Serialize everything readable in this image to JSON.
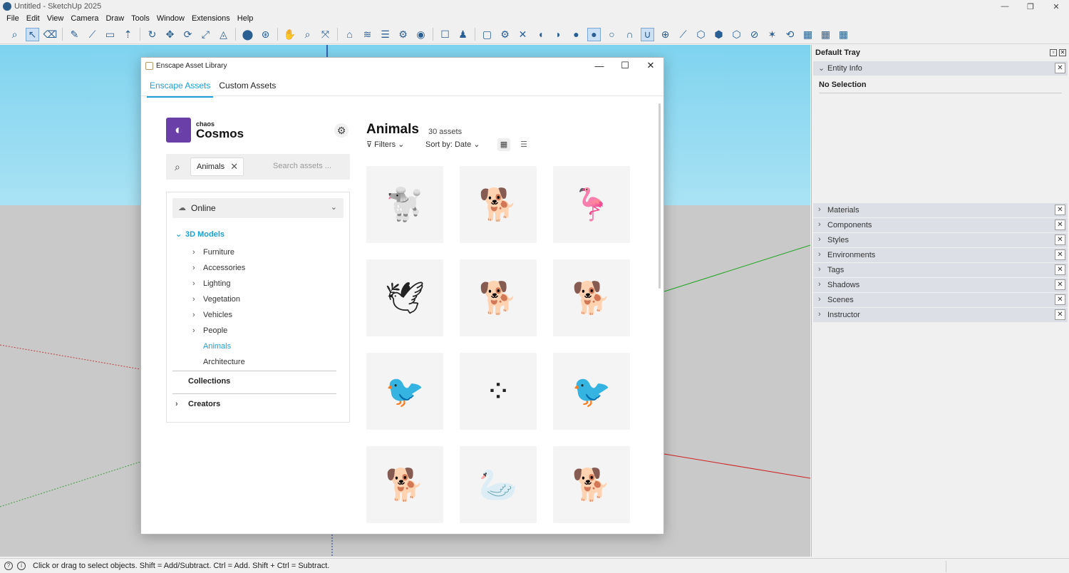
{
  "window": {
    "title": "Untitled - SketchUp 2025",
    "controls": [
      "—",
      "❐",
      "✕"
    ]
  },
  "menu": [
    "File",
    "Edit",
    "View",
    "Camera",
    "Draw",
    "Tools",
    "Window",
    "Extensions",
    "Help"
  ],
  "toolbar_icons": [
    {
      "name": "search-icon",
      "glyph": "⌕"
    },
    {
      "name": "select-icon",
      "glyph": "↖",
      "selected": true
    },
    {
      "name": "eraser-icon",
      "glyph": "⌫"
    },
    {
      "name": "pencil-icon",
      "glyph": "✎"
    },
    {
      "name": "line-icon",
      "glyph": "⟋"
    },
    {
      "name": "rectangle-icon",
      "glyph": "▭"
    },
    {
      "name": "push-pull-icon",
      "glyph": "⇡"
    },
    {
      "name": "offset-icon",
      "glyph": "↻"
    },
    {
      "name": "move-icon",
      "glyph": "✥"
    },
    {
      "name": "rotate-icon",
      "glyph": "⟳"
    },
    {
      "name": "scale-icon",
      "glyph": "⤢"
    },
    {
      "name": "protractor-icon",
      "glyph": "◬"
    },
    {
      "name": "paint-icon",
      "glyph": "⬤"
    },
    {
      "name": "orbit-icon",
      "glyph": "⊛"
    },
    {
      "name": "pan-icon",
      "glyph": "✋"
    },
    {
      "name": "zoom-icon",
      "glyph": "⌕"
    },
    {
      "name": "zoom-extents-icon",
      "glyph": "⤧"
    },
    {
      "name": "warehouse-icon",
      "glyph": "⌂"
    },
    {
      "name": "layers-icon",
      "glyph": "≋"
    },
    {
      "name": "stack-icon",
      "glyph": "☰"
    },
    {
      "name": "settings-icon",
      "glyph": "⚙"
    },
    {
      "name": "user-icon",
      "glyph": "◉"
    },
    {
      "name": "page-icon",
      "glyph": "☐"
    },
    {
      "name": "person-icon",
      "glyph": "♟"
    },
    {
      "name": "folder-icon",
      "glyph": "▢"
    },
    {
      "name": "gear-icon",
      "glyph": "⚙"
    },
    {
      "name": "close-icon",
      "glyph": "✕"
    },
    {
      "name": "drop-icon",
      "glyph": "◖"
    },
    {
      "name": "drop-half-icon",
      "glyph": "◗"
    },
    {
      "name": "drop-filled-icon",
      "glyph": "●"
    },
    {
      "name": "drop-selected-icon",
      "glyph": "●",
      "selected": true
    },
    {
      "name": "drop-outline-icon",
      "glyph": "○"
    },
    {
      "name": "magnet-icon",
      "glyph": "∩"
    },
    {
      "name": "magnet-selected-icon",
      "glyph": "∪",
      "selected": true
    },
    {
      "name": "add-icon",
      "glyph": "⊕"
    },
    {
      "name": "connect-icon",
      "glyph": "⟋"
    },
    {
      "name": "box-icon",
      "glyph": "⬡"
    },
    {
      "name": "shape-icon",
      "glyph": "⬢"
    },
    {
      "name": "cube-icon",
      "glyph": "⬡"
    },
    {
      "name": "no-icon",
      "glyph": "⊘"
    },
    {
      "name": "scatter-icon",
      "glyph": "✶"
    },
    {
      "name": "refresh-icon",
      "glyph": "⟲"
    },
    {
      "name": "grid-a-icon",
      "glyph": "▦"
    },
    {
      "name": "grid-b-icon",
      "glyph": "▦"
    },
    {
      "name": "grid-c-icon",
      "glyph": "▦"
    }
  ],
  "tray": {
    "title": "Default Tray",
    "entity_info": {
      "label": "Entity Info",
      "status": "No Selection"
    },
    "panels": [
      "Materials",
      "Components",
      "Styles",
      "Environments",
      "Tags",
      "Shadows",
      "Scenes",
      "Instructor"
    ]
  },
  "status": {
    "text": "Click or drag to select objects. Shift = Add/Subtract. Ctrl = Add. Shift + Ctrl = Subtract."
  },
  "dialog": {
    "title": "Enscape Asset Library",
    "controls": [
      "—",
      "☐",
      "✕"
    ],
    "tabs": [
      {
        "label": "Enscape Assets",
        "active": true
      },
      {
        "label": "Custom Assets",
        "active": false
      }
    ],
    "brand": {
      "small": "chaos",
      "large": "Cosmos"
    },
    "search": {
      "chip": "Animals",
      "placeholder": "Search assets ..."
    },
    "source": "Online",
    "category_root": "3D Models",
    "subcategories": [
      {
        "label": "Furniture",
        "expandable": true
      },
      {
        "label": "Accessories",
        "expandable": true
      },
      {
        "label": "Lighting",
        "expandable": true
      },
      {
        "label": "Vegetation",
        "expandable": true
      },
      {
        "label": "Vehicles",
        "expandable": true
      },
      {
        "label": "People",
        "expandable": true
      },
      {
        "label": "Animals",
        "expandable": false,
        "active": true
      },
      {
        "label": "Architecture",
        "expandable": false
      }
    ],
    "collections": "Collections",
    "creators": "Creators",
    "content": {
      "title": "Animals",
      "count": "30 assets",
      "filters": "Filters",
      "sort": "Sort by: Date"
    },
    "assets": [
      {
        "name": "poodle-thumbnail",
        "glyph": "🐩"
      },
      {
        "name": "golden-retriever-lying-thumbnail",
        "glyph": "🐕"
      },
      {
        "name": "flamingo-thumbnail",
        "glyph": "🦩"
      },
      {
        "name": "pigeon-flying-thumbnail",
        "glyph": "🕊"
      },
      {
        "name": "labrador-standing-thumbnail",
        "glyph": "🐕"
      },
      {
        "name": "labrador-sniffing-thumbnail",
        "glyph": "🐕"
      },
      {
        "name": "bullfinch-thumbnail",
        "glyph": "🐦"
      },
      {
        "name": "flock-of-birds-thumbnail",
        "glyph": "⁘"
      },
      {
        "name": "pigeon-thumbnail",
        "glyph": "🐦"
      },
      {
        "name": "golden-retriever-sitting-thumbnail",
        "glyph": "🐕"
      },
      {
        "name": "swan-thumbnail",
        "glyph": "🦢"
      },
      {
        "name": "golden-retriever-puppy-thumbnail",
        "glyph": "🐕"
      }
    ]
  }
}
